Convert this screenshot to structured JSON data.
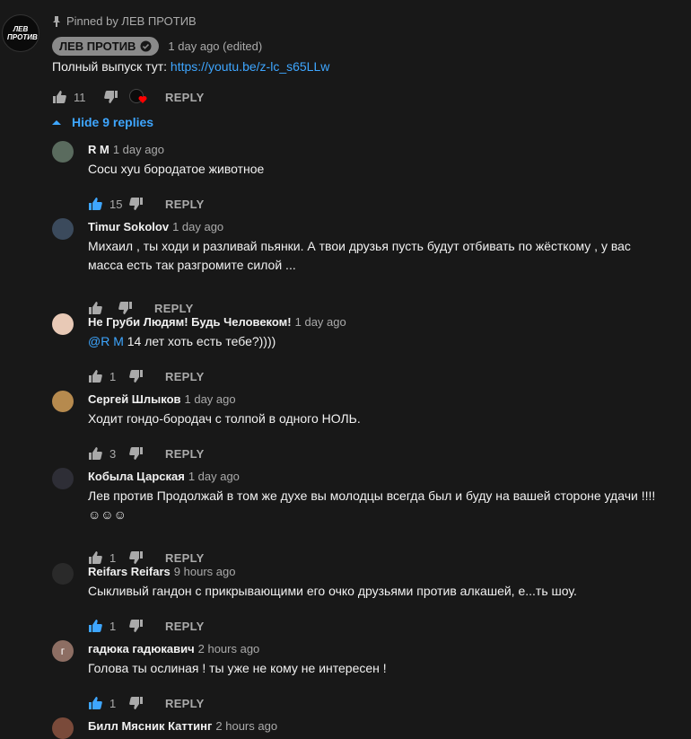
{
  "top_comment": {
    "pinned_text": "Pinned by ЛЕВ ПРОТИВ",
    "avatar_text": "ЛЕВ ПРОТИВ",
    "author": "ЛЕВ ПРОТИВ",
    "time": "1 day ago (edited)",
    "text_prefix": "Полный выпуск тут: ",
    "link": "https://youtu.be/z-lc_s65LLw",
    "likes": "11",
    "reply_label": "REPLY"
  },
  "hide_replies_label": "Hide 9 replies",
  "replies": [
    {
      "author": "R M",
      "time": "1 day ago",
      "text": "Cocu xyu бородатое животное",
      "likes": "15",
      "liked": true,
      "reply_label": "REPLY",
      "avatar_color": "#5a6b5e"
    },
    {
      "author": "Timur Sokolov",
      "time": "1 day ago",
      "text": "Михаил , ты ходи и разливай пьянки. А твои друзья пусть будут отбивать по жёсткому , у вас масса есть так разгромите силой ...",
      "likes": "",
      "liked": false,
      "reply_label": "REPLY",
      "avatar_color": "#3b4a5c"
    },
    {
      "author": "Не Груби Людям! Будь Человеком!",
      "time": "1 day ago",
      "mention": "@R M",
      "text": " 14 лет хоть есть тебе?))))",
      "likes": "1",
      "liked": false,
      "reply_label": "REPLY",
      "avatar_color": "#e8c9b6"
    },
    {
      "author": "Сергей Шлыков",
      "time": "1 day ago",
      "text": "Ходит гондо-бородач с толпой  в одного НОЛЬ.",
      "likes": "3",
      "liked": false,
      "reply_label": "REPLY",
      "avatar_color": "#b68a4e"
    },
    {
      "author": "Кобыла Царская",
      "time": "1 day ago",
      "text": "Лев против Продолжай в том же духе вы молодцы всегда был и буду на вашей стороне удачи !!!! ☺☺☺",
      "likes": "1",
      "liked": false,
      "reply_label": "REPLY",
      "avatar_color": "#2e2e36"
    },
    {
      "author": "Reifars Reifars",
      "time": "9 hours ago",
      "text": "Сыкливый гандон с прикрывающими его очко друзьями против алкашей, е...ть шоу.",
      "likes": "1",
      "liked": true,
      "reply_label": "REPLY",
      "avatar_color": "#2a2a2a"
    },
    {
      "author": "гадюка гадюкавич",
      "time": "2 hours ago",
      "avatar_letter": "г",
      "text": "Голова ты ослиная ! ты уже не кому не интересен !",
      "likes": "1",
      "liked": true,
      "reply_label": "REPLY",
      "avatar_color": "#8d6e63"
    },
    {
      "author": "Билл Мясник Каттинг",
      "time": "2 hours ago",
      "avatar_color": "#7a4a3a"
    }
  ],
  "colors": {
    "accent": "#3ea6ff",
    "background": "#181818",
    "muted": "#aaaaaa"
  }
}
